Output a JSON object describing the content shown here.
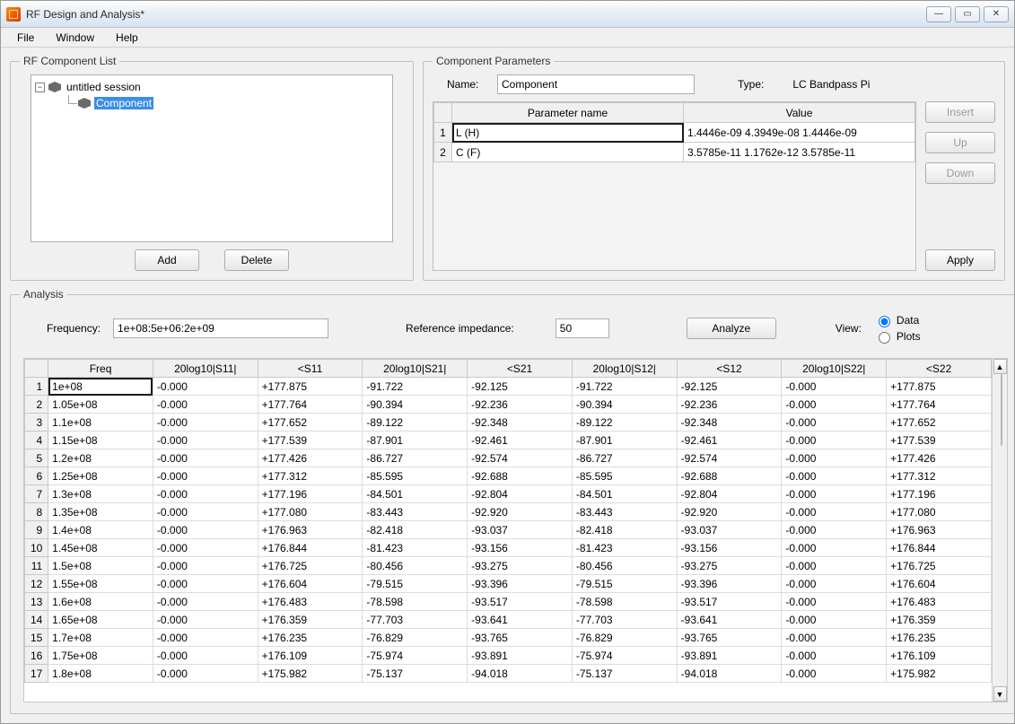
{
  "window": {
    "title": "RF Design and Analysis*"
  },
  "menubar": [
    "File",
    "Window",
    "Help"
  ],
  "rf_list": {
    "legend": "RF Component List",
    "root_label": "untitled session",
    "child_label": "Component",
    "btn_add": "Add",
    "btn_delete": "Delete"
  },
  "comp_params": {
    "legend": "Component Parameters",
    "name_label": "Name:",
    "name_value": "Component",
    "type_label": "Type:",
    "type_value": "LC Bandpass Pi",
    "col_param": "Parameter name",
    "col_value": "Value",
    "rows": [
      {
        "param": "L (H)",
        "value": "1.4446e-09 4.3949e-08 1.4446e-09"
      },
      {
        "param": "C (F)",
        "value": "3.5785e-11 1.1762e-12 3.5785e-11"
      }
    ],
    "btn_insert": "Insert",
    "btn_up": "Up",
    "btn_down": "Down",
    "btn_apply": "Apply"
  },
  "analysis": {
    "legend": "Analysis",
    "freq_label": "Frequency:",
    "freq_value": "1e+08:5e+06:2e+09",
    "refimp_label": "Reference impedance:",
    "refimp_value": "50",
    "btn_analyze": "Analyze",
    "view_label": "View:",
    "radio_data": "Data",
    "radio_plots": "Plots",
    "columns": [
      "Freq",
      "20log10|S11|",
      "<S11",
      "20log10|S21|",
      "<S21",
      "20log10|S12|",
      "<S12",
      "20log10|S22|",
      "<S22"
    ],
    "rows": [
      [
        "1e+08",
        "-0.000",
        "+177.875",
        "-91.722",
        "-92.125",
        "-91.722",
        "-92.125",
        "-0.000",
        "+177.875"
      ],
      [
        "1.05e+08",
        "-0.000",
        "+177.764",
        "-90.394",
        "-92.236",
        "-90.394",
        "-92.236",
        "-0.000",
        "+177.764"
      ],
      [
        "1.1e+08",
        "-0.000",
        "+177.652",
        "-89.122",
        "-92.348",
        "-89.122",
        "-92.348",
        "-0.000",
        "+177.652"
      ],
      [
        "1.15e+08",
        "-0.000",
        "+177.539",
        "-87.901",
        "-92.461",
        "-87.901",
        "-92.461",
        "-0.000",
        "+177.539"
      ],
      [
        "1.2e+08",
        "-0.000",
        "+177.426",
        "-86.727",
        "-92.574",
        "-86.727",
        "-92.574",
        "-0.000",
        "+177.426"
      ],
      [
        "1.25e+08",
        "-0.000",
        "+177.312",
        "-85.595",
        "-92.688",
        "-85.595",
        "-92.688",
        "-0.000",
        "+177.312"
      ],
      [
        "1.3e+08",
        "-0.000",
        "+177.196",
        "-84.501",
        "-92.804",
        "-84.501",
        "-92.804",
        "-0.000",
        "+177.196"
      ],
      [
        "1.35e+08",
        "-0.000",
        "+177.080",
        "-83.443",
        "-92.920",
        "-83.443",
        "-92.920",
        "-0.000",
        "+177.080"
      ],
      [
        "1.4e+08",
        "-0.000",
        "+176.963",
        "-82.418",
        "-93.037",
        "-82.418",
        "-93.037",
        "-0.000",
        "+176.963"
      ],
      [
        "1.45e+08",
        "-0.000",
        "+176.844",
        "-81.423",
        "-93.156",
        "-81.423",
        "-93.156",
        "-0.000",
        "+176.844"
      ],
      [
        "1.5e+08",
        "-0.000",
        "+176.725",
        "-80.456",
        "-93.275",
        "-80.456",
        "-93.275",
        "-0.000",
        "+176.725"
      ],
      [
        "1.55e+08",
        "-0.000",
        "+176.604",
        "-79.515",
        "-93.396",
        "-79.515",
        "-93.396",
        "-0.000",
        "+176.604"
      ],
      [
        "1.6e+08",
        "-0.000",
        "+176.483",
        "-78.598",
        "-93.517",
        "-78.598",
        "-93.517",
        "-0.000",
        "+176.483"
      ],
      [
        "1.65e+08",
        "-0.000",
        "+176.359",
        "-77.703",
        "-93.641",
        "-77.703",
        "-93.641",
        "-0.000",
        "+176.359"
      ],
      [
        "1.7e+08",
        "-0.000",
        "+176.235",
        "-76.829",
        "-93.765",
        "-76.829",
        "-93.765",
        "-0.000",
        "+176.235"
      ],
      [
        "1.75e+08",
        "-0.000",
        "+176.109",
        "-75.974",
        "-93.891",
        "-75.974",
        "-93.891",
        "-0.000",
        "+176.109"
      ],
      [
        "1.8e+08",
        "-0.000",
        "+175.982",
        "-75.137",
        "-94.018",
        "-75.137",
        "-94.018",
        "-0.000",
        "+175.982"
      ]
    ]
  }
}
